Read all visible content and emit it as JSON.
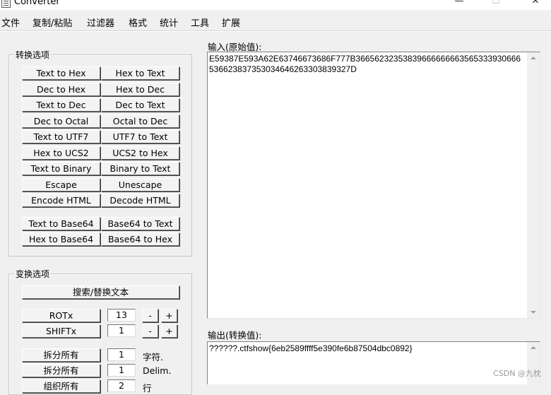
{
  "window": {
    "title": "Converter",
    "minimize": "—",
    "maximize": "☐",
    "close": "✕"
  },
  "menu": [
    "文件",
    "复制/粘贴",
    "过滤器",
    "格式",
    "统计",
    "工具",
    "扩展"
  ],
  "conversion_group": {
    "title": "转换选项",
    "rows": [
      [
        "Text to Hex",
        "Hex to Text"
      ],
      [
        "Dec to Hex",
        "Hex to Dec"
      ],
      [
        "Text to Dec",
        "Dec to Text"
      ],
      [
        "Dec to Octal",
        "Octal to Dec"
      ],
      [
        "Text to UTF7",
        "UTF7 to Text"
      ],
      [
        "Hex to UCS2",
        "UCS2 to Hex"
      ],
      [
        "Text to Binary",
        "Binary to Text"
      ],
      [
        "Escape",
        "Unescape"
      ],
      [
        "Encode HTML",
        "Decode HTML"
      ],
      [
        "Text to Base64",
        "Base64 to Text"
      ],
      [
        "Hex to Base64",
        "Base64 to Hex"
      ]
    ]
  },
  "transform_group": {
    "title": "变换选项",
    "search_replace": "搜索/替换文本",
    "rot_label": "ROTx",
    "rot_value": "13",
    "shift_label": "SHIFTx",
    "shift_value": "1",
    "minus": "-",
    "plus": "+",
    "split_all_1": "拆分所有",
    "split_all_1_value": "1",
    "split_all_1_unit": "字符.",
    "split_all_2": "拆分所有",
    "split_all_2_value": "1",
    "split_all_2_unit": "Delim.",
    "row3_label": "组织所有",
    "row3_value": "2",
    "row3_unit": "行"
  },
  "input": {
    "label": "输入(原始值):",
    "value": "E59387E593A62E63746673686F777B36656232353839666666663565333930666536623837353034646263303839327D"
  },
  "output": {
    "label": "输出(转换值):",
    "value": "??????.ctfshow{6eb2589ffff5e390fe6b87504dbc0892}"
  },
  "watermark": "CSDN @九枕",
  "colors": {
    "background": "#f0f0f0",
    "field": "#ffffff",
    "border": "#828282"
  },
  "icons": [
    "app-icon",
    "scroll-up-arrow-icon",
    "scroll-down-arrow-icon"
  ]
}
